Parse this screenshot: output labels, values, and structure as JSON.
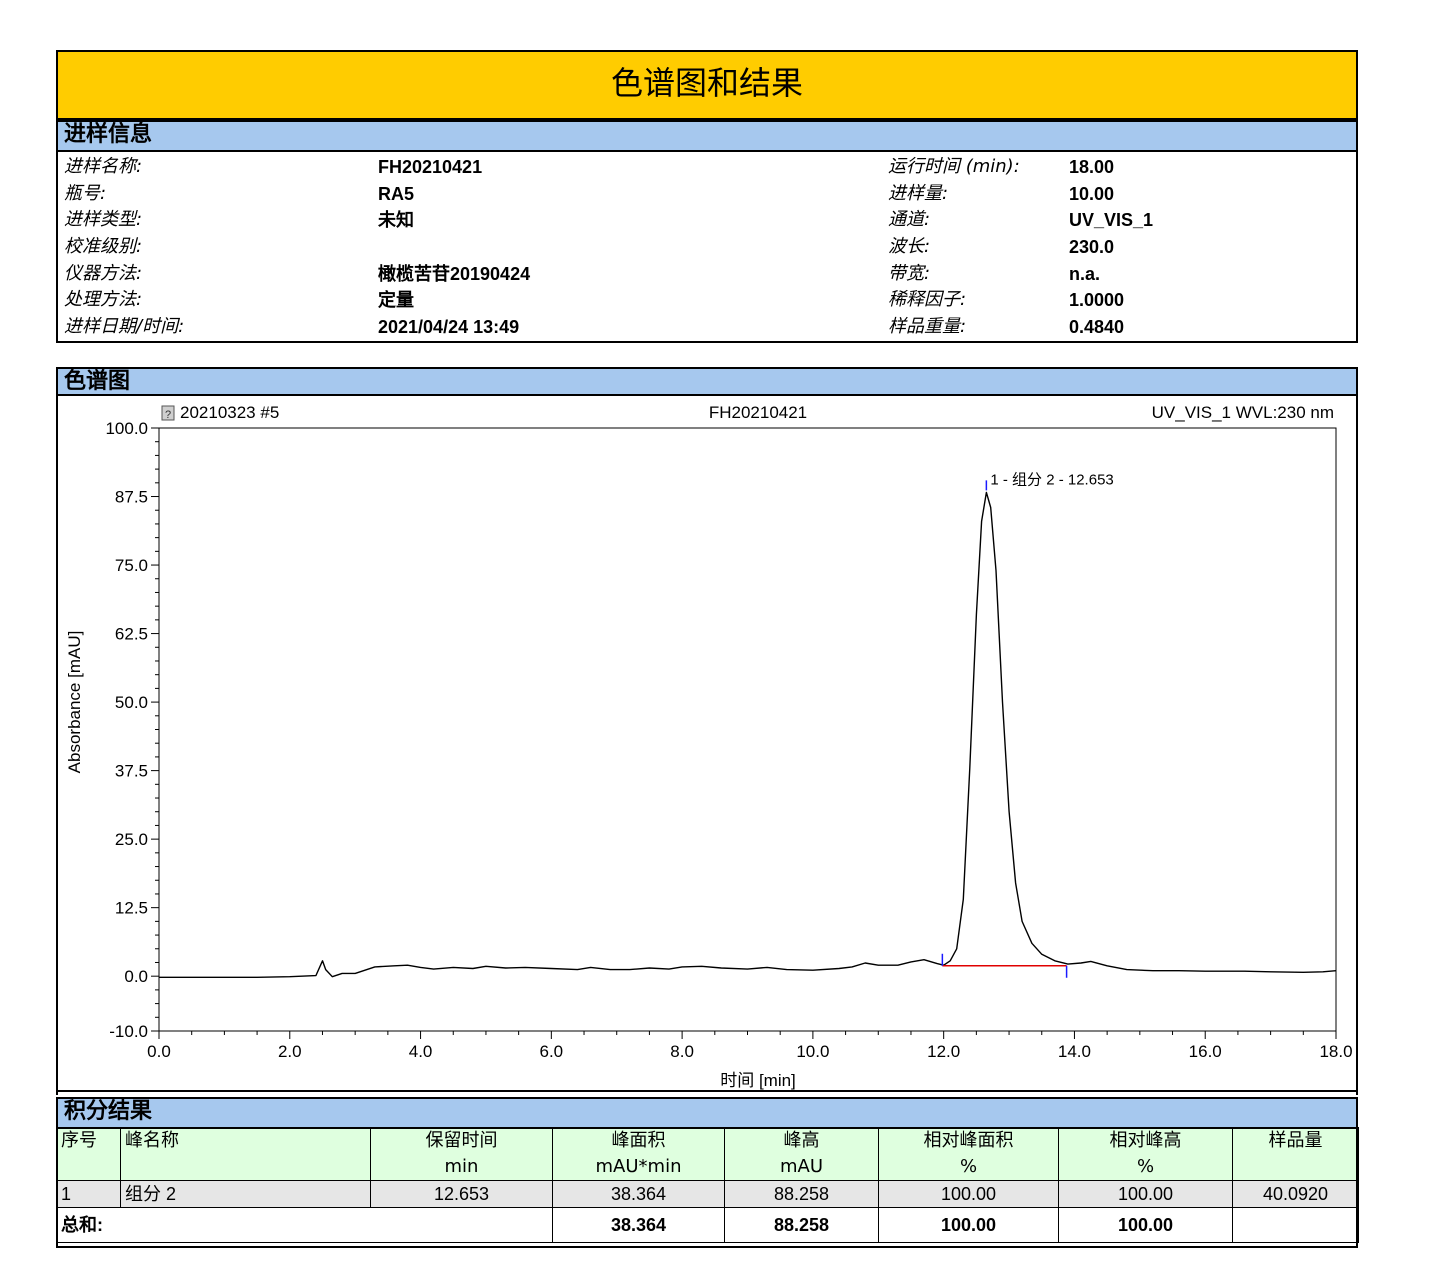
{
  "report": {
    "title": "色谱图和结果"
  },
  "sample_info": {
    "header": "进样信息",
    "left": [
      {
        "label": "进样名称:",
        "value": "FH20210421"
      },
      {
        "label": "瓶号:",
        "value": "RA5"
      },
      {
        "label": "进样类型:",
        "value": "未知"
      },
      {
        "label": "校准级别:",
        "value": ""
      },
      {
        "label": "仪器方法:",
        "value": "橄榄苦苷20190424"
      },
      {
        "label": "处理方法:",
        "value": "定量"
      },
      {
        "label": "进样日期/时间:",
        "value": "2021/04/24 13:49"
      }
    ],
    "right": [
      {
        "label": "运行时间 (min):",
        "value": "18.00"
      },
      {
        "label": "进样量:",
        "value": "10.00"
      },
      {
        "label": "通道:",
        "value": "UV_VIS_1"
      },
      {
        "label": "波长:",
        "value": "230.0"
      },
      {
        "label": "带宽:",
        "value": "n.a."
      },
      {
        "label": "稀释因子:",
        "value": "1.0000"
      },
      {
        "label": "样品重量:",
        "value": "0.4840"
      }
    ]
  },
  "chromatogram": {
    "header": "色谱图",
    "header_left": "20210323 #5",
    "header_center": "FH20210421",
    "header_right": "UV_VIS_1 WVL:230 nm"
  },
  "chart_data": {
    "type": "line",
    "xlabel": "时间 [min]",
    "ylabel": "Absorbance [mAU]",
    "xlim": [
      0.0,
      18.0
    ],
    "ylim": [
      -10.0,
      100.0
    ],
    "x_ticks": [
      "0.0",
      "2.0",
      "4.0",
      "6.0",
      "8.0",
      "10.0",
      "12.0",
      "14.0",
      "16.0",
      "18.0"
    ],
    "y_ticks": [
      "-10.0",
      "0.0",
      "12.5",
      "25.0",
      "37.5",
      "50.0",
      "62.5",
      "75.0",
      "87.5",
      "100.0"
    ],
    "grid": false,
    "series": [
      {
        "values": [
          [
            0.0,
            -0.2
          ],
          [
            1.5,
            -0.2
          ],
          [
            2.0,
            -0.1
          ],
          [
            2.4,
            0.1
          ],
          [
            2.5,
            2.8
          ],
          [
            2.55,
            1.2
          ],
          [
            2.65,
            -0.1
          ],
          [
            2.8,
            0.5
          ],
          [
            3.0,
            0.5
          ],
          [
            3.3,
            1.7
          ],
          [
            3.6,
            1.9
          ],
          [
            3.8,
            2.0
          ],
          [
            4.0,
            1.6
          ],
          [
            4.2,
            1.3
          ],
          [
            4.5,
            1.6
          ],
          [
            4.8,
            1.4
          ],
          [
            5.0,
            1.8
          ],
          [
            5.3,
            1.5
          ],
          [
            5.6,
            1.6
          ],
          [
            6.0,
            1.4
          ],
          [
            6.4,
            1.2
          ],
          [
            6.6,
            1.6
          ],
          [
            6.9,
            1.2
          ],
          [
            7.2,
            1.2
          ],
          [
            7.5,
            1.5
          ],
          [
            7.8,
            1.3
          ],
          [
            8.0,
            1.7
          ],
          [
            8.3,
            1.8
          ],
          [
            8.6,
            1.5
          ],
          [
            9.0,
            1.3
          ],
          [
            9.3,
            1.6
          ],
          [
            9.6,
            1.2
          ],
          [
            10.0,
            1.1
          ],
          [
            10.4,
            1.4
          ],
          [
            10.6,
            1.7
          ],
          [
            10.8,
            2.4
          ],
          [
            11.0,
            2.0
          ],
          [
            11.3,
            2.0
          ],
          [
            11.5,
            2.6
          ],
          [
            11.7,
            3.0
          ],
          [
            11.9,
            2.3
          ],
          [
            12.0,
            2.0
          ],
          [
            12.1,
            2.8
          ],
          [
            12.2,
            5.0
          ],
          [
            12.3,
            14.0
          ],
          [
            12.4,
            38.0
          ],
          [
            12.5,
            66.0
          ],
          [
            12.58,
            83.0
          ],
          [
            12.653,
            88.258
          ],
          [
            12.72,
            85.5
          ],
          [
            12.8,
            74.0
          ],
          [
            12.9,
            50.0
          ],
          [
            13.0,
            30.0
          ],
          [
            13.1,
            17.0
          ],
          [
            13.2,
            10.0
          ],
          [
            13.35,
            6.0
          ],
          [
            13.5,
            4.0
          ],
          [
            13.7,
            2.8
          ],
          [
            13.9,
            2.2
          ],
          [
            14.1,
            2.4
          ],
          [
            14.25,
            2.7
          ],
          [
            14.5,
            1.9
          ],
          [
            14.8,
            1.2
          ],
          [
            15.2,
            1.0
          ],
          [
            15.6,
            1.0
          ],
          [
            16.0,
            0.9
          ],
          [
            16.6,
            0.9
          ],
          [
            17.0,
            0.8
          ],
          [
            17.5,
            0.7
          ],
          [
            17.8,
            0.8
          ],
          [
            18.0,
            1.0
          ]
        ]
      }
    ],
    "baseline": {
      "x": [
        11.98,
        13.88
      ],
      "y": [
        1.9,
        1.9
      ],
      "color": "#e00000"
    },
    "peak_markers": [
      11.98,
      13.88
    ],
    "peak_label": {
      "text": "1 - 组分 2 - 12.653",
      "x": 12.653,
      "y": 88.258
    },
    "line_color": "#000000",
    "marker_color": "#1a1aff"
  },
  "results": {
    "header": "积分结果",
    "columns": [
      {
        "name": "序号",
        "unit": ""
      },
      {
        "name": "峰名称",
        "unit": ""
      },
      {
        "name": "保留时间",
        "unit": "min"
      },
      {
        "name": "峰面积",
        "unit": "mAU*min"
      },
      {
        "name": "峰高",
        "unit": "mAU"
      },
      {
        "name": "相对峰面积",
        "unit": "%"
      },
      {
        "name": "相对峰高",
        "unit": "%"
      },
      {
        "name": "样品量",
        "unit": ""
      }
    ],
    "rows": [
      [
        "1",
        "组分 2",
        "12.653",
        "38.364",
        "88.258",
        "100.00",
        "100.00",
        "40.0920"
      ]
    ],
    "total": {
      "label": "总和:",
      "area": "38.364",
      "height": "88.258",
      "rel_area": "100.00",
      "rel_height": "100.00"
    }
  }
}
